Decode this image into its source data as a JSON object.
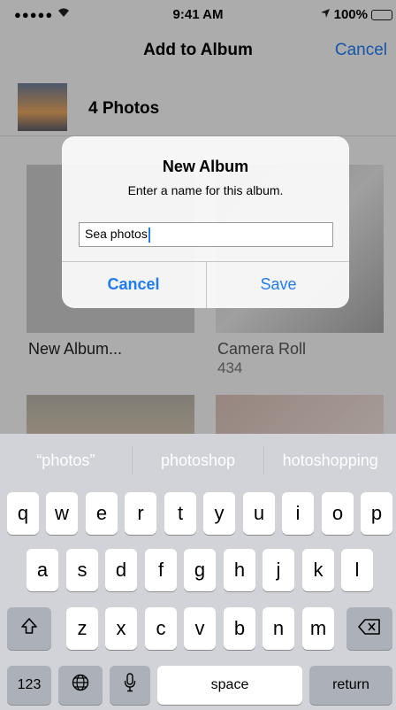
{
  "status_bar": {
    "signal": "●●●●●",
    "wifi_icon": "wifi-icon",
    "time": "9:41 AM",
    "location_icon": "location-arrow-icon",
    "battery": "100%"
  },
  "nav": {
    "title": "Add to Album",
    "cancel_label": "Cancel"
  },
  "photos_row": {
    "label": "4 Photos"
  },
  "albums": [
    {
      "name": "New Album..."
    },
    {
      "name": "Camera Roll",
      "count": "434"
    }
  ],
  "alert": {
    "title": "New Album",
    "message": "Enter a name for this album.",
    "input_value": "Sea photos",
    "cancel_label": "Cancel",
    "save_label": "Save"
  },
  "keyboard": {
    "predictions": [
      "“photos”",
      "photoshop",
      "hotoshopping"
    ],
    "row1": [
      "q",
      "w",
      "e",
      "r",
      "t",
      "y",
      "u",
      "i",
      "o",
      "p"
    ],
    "row2": [
      "a",
      "s",
      "d",
      "f",
      "g",
      "h",
      "j",
      "k",
      "l"
    ],
    "row3": [
      "z",
      "x",
      "c",
      "v",
      "b",
      "n",
      "m"
    ],
    "numbers_label": "123",
    "space_label": "space",
    "return_label": "return",
    "shift_icon": "shift-icon",
    "delete_icon": "delete-icon",
    "globe_icon": "globe-icon",
    "mic_icon": "microphone-icon"
  },
  "colors": {
    "accent": "#1e7cf2",
    "battery": "#4cd964"
  }
}
